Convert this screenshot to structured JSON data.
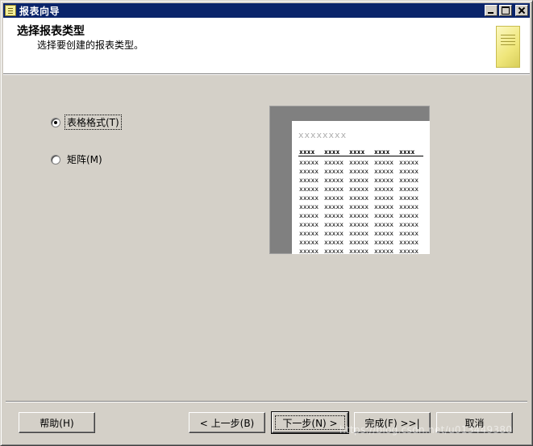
{
  "window": {
    "title": "报表向导"
  },
  "header": {
    "title": "选择报表类型",
    "subtitle": "选择要创建的报表类型。"
  },
  "options": [
    {
      "label": "表格格式(T)",
      "checked": true
    },
    {
      "label": "矩阵(M)",
      "checked": false
    }
  ],
  "preview": {
    "title_placeholder": "xxxxxxxx",
    "header_cells": [
      "xxxx",
      "xxxx",
      "xxxx",
      "xxxx",
      "xxxx"
    ],
    "row_cell": "xxxxx",
    "row_count": 11
  },
  "buttons": {
    "help": "帮助(H)",
    "back": "< 上一步(B)",
    "next": "下一步(N) >",
    "finish": "完成(F) >>|",
    "cancel": "取消"
  },
  "watermark": "https://blog.csdn.net/u013449380",
  "colors": {
    "titlebar": "#0a246a",
    "dialog": "#d4d0c8"
  }
}
